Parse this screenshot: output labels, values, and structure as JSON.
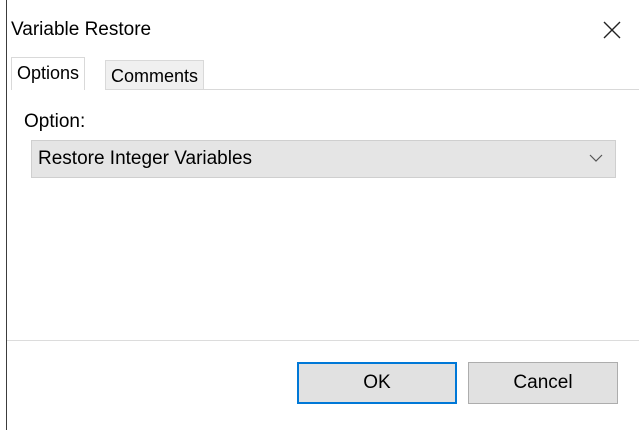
{
  "window": {
    "title": "Variable Restore"
  },
  "icons": {
    "close": "close-icon",
    "dropdown": "chevron-down-icon"
  },
  "tabs": [
    {
      "label": "Options",
      "active": true
    },
    {
      "label": "Comments",
      "active": false
    }
  ],
  "options_panel": {
    "option_label": "Option:",
    "selected_option": "Restore Integer Variables"
  },
  "buttons": {
    "ok_label": "OK",
    "cancel_label": "Cancel"
  },
  "colors": {
    "accent": "#0078d7",
    "select_bg": "#e5e5e5",
    "button_bg": "#e1e1e1"
  }
}
